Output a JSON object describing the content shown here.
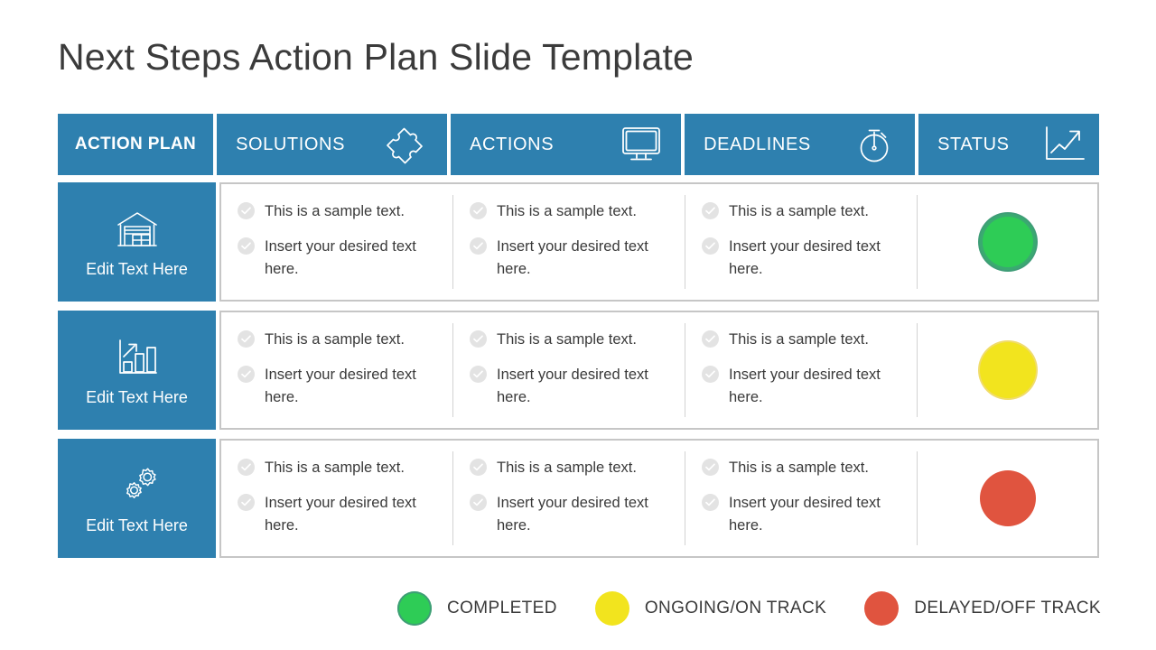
{
  "slide": {
    "title": "Next Steps Action Plan Slide Template",
    "accent_blue": "#2E80AF",
    "text_gray": "#3a3a3a",
    "panel_border": "#c6c6c6"
  },
  "header": {
    "columns": [
      {
        "label": "ACTION PLAN",
        "icon": "none",
        "bold": true
      },
      {
        "label": "SOLUTIONS",
        "icon": "puzzle-piece-icon",
        "bold": false
      },
      {
        "label": "ACTIONS",
        "icon": "monitor-icon",
        "bold": false
      },
      {
        "label": "DEADLINES",
        "icon": "stopwatch-icon",
        "bold": false
      },
      {
        "label": "STATUS",
        "icon": "growth-chart-icon",
        "bold": false
      }
    ]
  },
  "rows": [
    {
      "label": "Edit Text Here",
      "icon": "warehouse-icon",
      "solutions": [
        "This is a sample text.",
        "Insert your desired text here."
      ],
      "actions": [
        "This is a sample text.",
        "Insert your desired text here."
      ],
      "deadlines": [
        "This is a sample text.",
        "Insert your desired text here."
      ],
      "status": "completed",
      "status_color": "#2ECC56"
    },
    {
      "label": "Edit Text Here",
      "icon": "bar-chart-growth-icon",
      "solutions": [
        "This is a sample text.",
        "Insert your desired text here."
      ],
      "actions": [
        "This is a sample text.",
        "Insert your desired text here."
      ],
      "deadlines": [
        "This is a sample text.",
        "Insert your desired text here."
      ],
      "status": "ongoing",
      "status_color": "#F2E41E"
    },
    {
      "label": "Edit Text Here",
      "icon": "gears-icon",
      "solutions": [
        "This is a sample text.",
        "Insert your desired text here."
      ],
      "actions": [
        "This is a sample text.",
        "Insert your desired text here."
      ],
      "deadlines": [
        "This is a sample text.",
        "Insert your desired text here."
      ],
      "status": "delayed",
      "status_color": "#E0543F"
    }
  ],
  "legend": {
    "items": [
      {
        "label": "COMPLETED",
        "color": "#2ECC56"
      },
      {
        "label": "ONGOING/ON  TRACK",
        "color": "#F2E41E"
      },
      {
        "label": "DELAYED/OFF TRACK",
        "color": "#E0543F"
      }
    ]
  }
}
